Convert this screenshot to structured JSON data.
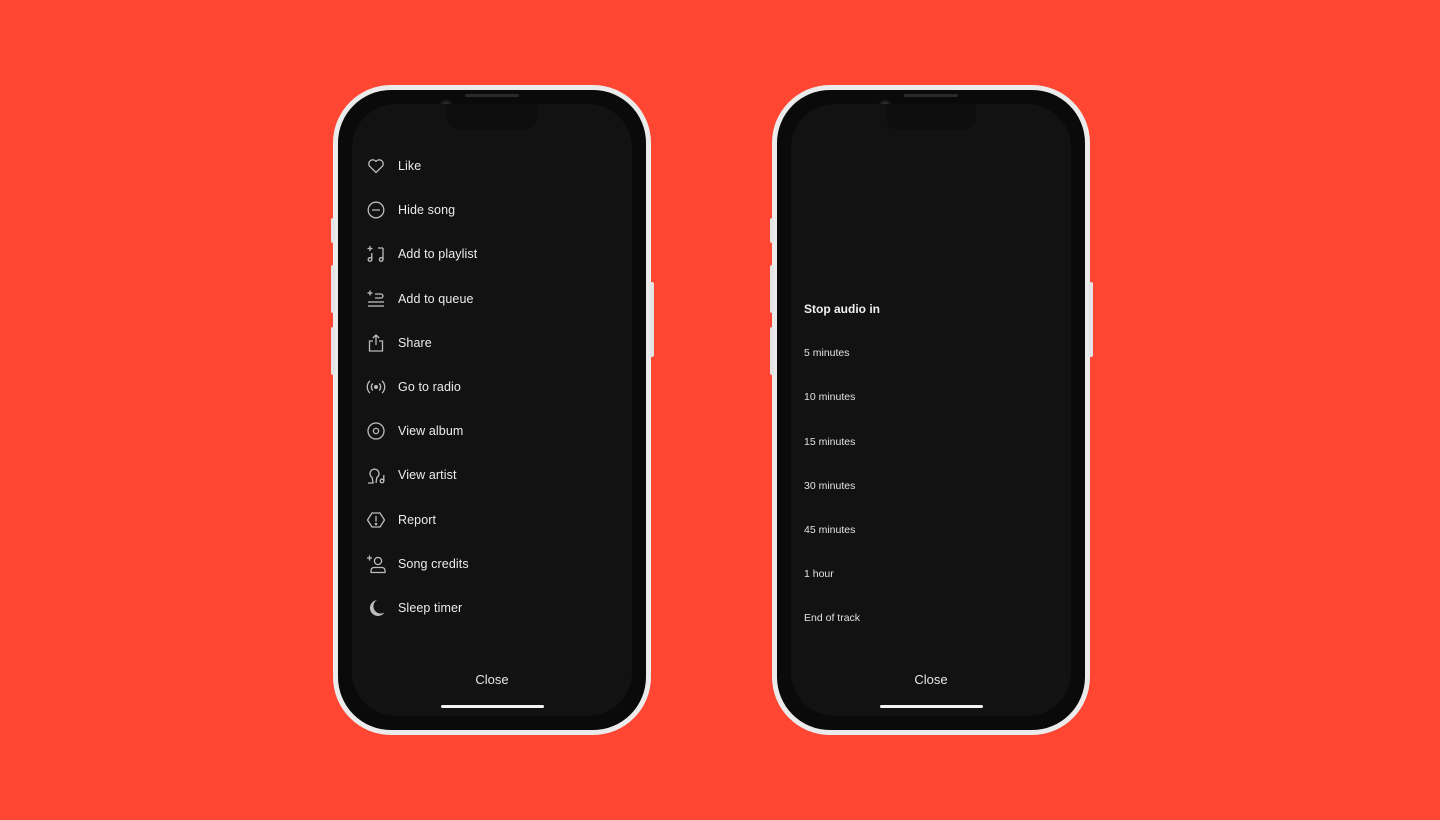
{
  "colors": {
    "background": "#FF4632",
    "screen": "#121212",
    "text": "#ECECEC",
    "icon": "#BDBDBD"
  },
  "left_phone": {
    "menu": [
      {
        "label": "Like",
        "icon": "heart-icon"
      },
      {
        "label": "Hide song",
        "icon": "minus-circle-icon"
      },
      {
        "label": "Add to playlist",
        "icon": "add-to-playlist-icon"
      },
      {
        "label": "Add to queue",
        "icon": "add-to-queue-icon"
      },
      {
        "label": "Share",
        "icon": "share-icon"
      },
      {
        "label": "Go to radio",
        "icon": "radio-icon"
      },
      {
        "label": "View album",
        "icon": "album-icon"
      },
      {
        "label": "View artist",
        "icon": "artist-icon"
      },
      {
        "label": "Report",
        "icon": "report-icon"
      },
      {
        "label": "Song credits",
        "icon": "song-credits-icon"
      },
      {
        "label": "Sleep timer",
        "icon": "moon-icon"
      }
    ],
    "close_label": "Close"
  },
  "right_phone": {
    "title": "Stop audio in",
    "options": [
      "5 minutes",
      "10 minutes",
      "15 minutes",
      "30 minutes",
      "45 minutes",
      "1 hour",
      "End of track"
    ],
    "close_label": "Close"
  }
}
